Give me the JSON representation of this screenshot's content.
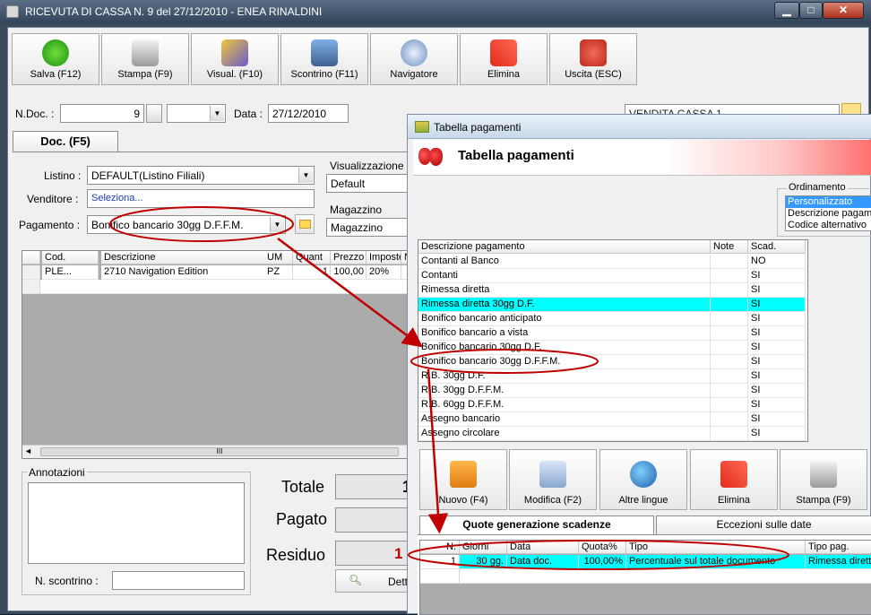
{
  "window": {
    "title": "RICEVUTA DI CASSA N. 9  del 27/12/2010 - ENEA RINALDINI",
    "min": "▁",
    "max": "□",
    "close": "✕"
  },
  "toolbar": [
    {
      "label": "Salva (F12)",
      "icon": "check-icon"
    },
    {
      "label": "Stampa (F9)",
      "icon": "printer-icon"
    },
    {
      "label": "Visual. (F10)",
      "icon": "magic-wand-icon"
    },
    {
      "label": "Scontrino (F11)",
      "icon": "cash-register-icon"
    },
    {
      "label": "Navigatore",
      "icon": "compass-icon"
    },
    {
      "label": "Elimina",
      "icon": "delete-x-icon"
    },
    {
      "label": "Uscita (ESC)",
      "icon": "power-icon"
    }
  ],
  "form": {
    "ndoc_label": "N.Doc. :",
    "ndoc_value": "9",
    "data_label": "Data :",
    "data_value": "27/12/2010",
    "deposito_value": "VENDITA CASSA 1",
    "tab_doc": "Doc. (F5)",
    "listino_label": "Listino :",
    "listino_value": "DEFAULT(Listino Filiali)",
    "venditore_label": "Venditore :",
    "venditore_value": "Seleziona...",
    "pagamento_label": "Pagamento :",
    "pagamento_value": "Bonifico bancario 30gg D.F.F.M.",
    "visualizzazione_label": "Visualizzazione",
    "visualizzazione_value": "Default",
    "magazzino_label": "Magazzino",
    "magazzino_value": "Magazzino"
  },
  "items_table": {
    "headers": [
      "Cod.",
      "Descrizione",
      "UM",
      "Quant",
      "Prezzo",
      "Imposte",
      "N"
    ],
    "rows": [
      [
        "PLE...",
        "2710 Navigation Edition",
        "PZ",
        "1",
        "100,00",
        "20%",
        ""
      ]
    ],
    "scroll_thumb": "III"
  },
  "footer": {
    "annotazioni_label": "Annotazioni",
    "scontrino_label": "N. scontrino :",
    "totale_label": "Totale",
    "totale_value": "1",
    "pagato_label": "Pagato",
    "residuo_label": "Residuo",
    "dett_label": "Dett"
  },
  "dialog": {
    "title": "Tabella pagamenti",
    "header": "Tabella pagamenti",
    "ordinamento_label": "Ordinamento",
    "ordinamento_options": [
      "Personalizzato",
      "Descrizione pagamento",
      "Codice alternativo"
    ],
    "ordinamento_selected": "Personalizzato",
    "headers": [
      "Descrizione pagamento",
      "Note",
      "Scad."
    ],
    "rows": [
      [
        "Contanti al Banco",
        "",
        "NO"
      ],
      [
        "Contanti",
        "",
        "SI"
      ],
      [
        "Rimessa diretta",
        "",
        "SI"
      ],
      [
        "Rimessa diretta 30gg D.F.",
        "",
        "SI"
      ],
      [
        "Bonifico bancario anticipato",
        "",
        "SI"
      ],
      [
        "Bonifico bancario a vista",
        "",
        "SI"
      ],
      [
        "Bonifico bancario 30gg D.F.",
        "",
        "SI"
      ],
      [
        "Bonifico bancario 30gg D.F.F.M.",
        "",
        "SI"
      ],
      [
        "R.B. 30gg D.F.",
        "",
        "SI"
      ],
      [
        "R.B. 30gg D.F.F.M.",
        "",
        "SI"
      ],
      [
        "R.B. 60gg D.F.F.M.",
        "",
        "SI"
      ],
      [
        "Assegno bancario",
        "",
        "SI"
      ],
      [
        "Assegno circolare",
        "",
        "SI"
      ]
    ],
    "selected_row": "Rimessa diretta 30gg D.F.",
    "buttons": [
      {
        "label": "Nuovo (F4)",
        "icon": "new-grid-icon"
      },
      {
        "label": "Modifica (F2)",
        "icon": "edit-document-icon"
      },
      {
        "label": "Altre lingue",
        "icon": "globe-icon"
      },
      {
        "label": "Elimina",
        "icon": "delete-x-icon"
      },
      {
        "label": "Stampa (F9)",
        "icon": "printer-icon"
      }
    ],
    "tabs": [
      "Quote generazione scadenze",
      "Eccezioni sulle date"
    ],
    "quote_headers": [
      "N.",
      "Giorni",
      "Data",
      "Quota%",
      "Tipo",
      "Tipo pag."
    ],
    "quote_rows": [
      [
        "1",
        "30 gg.",
        "Data doc.",
        "100,00%",
        "Percentuale sul totale documento",
        "Rimessa diretta"
      ]
    ]
  },
  "annotation": {
    "marker": "1"
  },
  "colors": {
    "highlight": "#00ffff",
    "accent_red": "#c00000",
    "selection_blue": "#3399ff"
  }
}
